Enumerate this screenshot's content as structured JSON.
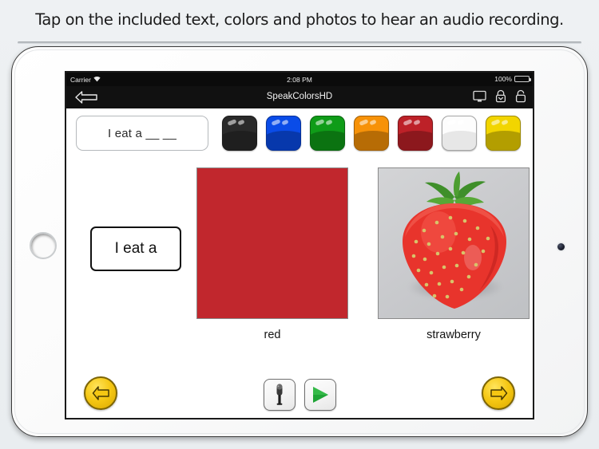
{
  "caption": {
    "text": "Tap on the included text, colors and photos to hear an audio recording."
  },
  "device": {
    "home_button": "home-button",
    "camera": "front-camera"
  },
  "status_bar": {
    "carrier": "Carrier",
    "wifi_icon": "wifi-icon",
    "time": "2:08 PM",
    "battery_percent": "100%",
    "battery_icon": "battery-full-icon"
  },
  "nav_bar": {
    "back_icon": "back-arrow-icon",
    "title": "SpeakColorsHD",
    "icons": [
      {
        "name": "display-icon"
      },
      {
        "name": "lock-down-icon"
      },
      {
        "name": "unlock-icon"
      }
    ]
  },
  "sentence_strip": {
    "value": "I eat a __ __",
    "placeholder": "I eat a __ __"
  },
  "swatches": [
    {
      "name": "swatch-black",
      "label": "black",
      "color": "#2a2a2a",
      "light": false
    },
    {
      "name": "swatch-blue",
      "label": "blue",
      "color": "#0a4ce8",
      "light": false
    },
    {
      "name": "swatch-green",
      "label": "green",
      "color": "#0f9c18",
      "light": false
    },
    {
      "name": "swatch-orange",
      "label": "orange",
      "color": "#f79208",
      "light": false
    },
    {
      "name": "swatch-red",
      "label": "red",
      "color": "#bd2128",
      "light": false
    },
    {
      "name": "swatch-white",
      "label": "white",
      "color": "#fdfdfd",
      "light": true
    },
    {
      "name": "swatch-yellow",
      "label": "yellow",
      "color": "#f2d500",
      "light": false
    }
  ],
  "phrase_card": {
    "text": "I eat a"
  },
  "items": [
    {
      "name": "color-swatch-card",
      "kind": "color",
      "label": "red",
      "color": "#C1272D"
    },
    {
      "name": "photo-card",
      "kind": "photo",
      "label": "strawberry",
      "photo_subject": "strawberry",
      "background": "#cacbce"
    }
  ],
  "bottom_bar": {
    "prev_label": "previous-page",
    "next_label": "next-page",
    "record_label": "record-audio",
    "play_label": "play-audio",
    "accent_yellow": "#f5c713",
    "play_green": "#1fa436"
  }
}
